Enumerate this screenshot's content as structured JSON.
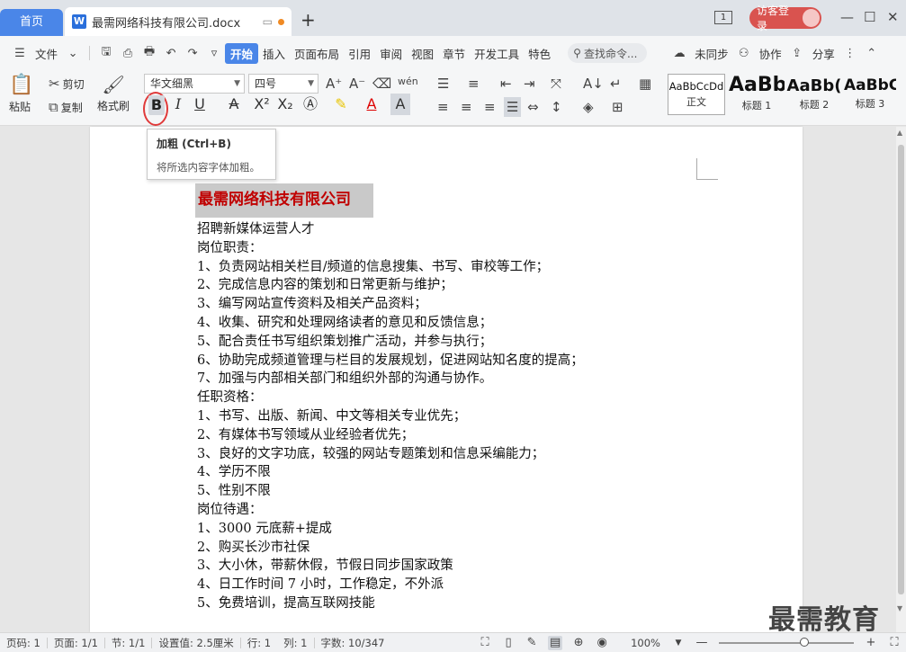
{
  "titlebar": {
    "home_tab": "首页",
    "doc_tab": "最需网络科技有限公司.docx",
    "doc_icon_letter": "W",
    "new_tab": "+",
    "login": "访客登录"
  },
  "menu": {
    "file": "文件",
    "items": [
      "开始",
      "插入",
      "页面布局",
      "引用",
      "审阅",
      "视图",
      "章节",
      "开发工具",
      "特色"
    ],
    "search_placeholder": "查找命令...",
    "sync": "未同步",
    "collab": "协作",
    "share": "分享"
  },
  "ribbon": {
    "paste": "粘贴",
    "cut": "剪切",
    "copy": "复制",
    "format_painter": "格式刷",
    "font_name": "华文细黑",
    "font_size": "四号",
    "styles": [
      {
        "preview": "AaBbCcDd",
        "name": "正文"
      },
      {
        "preview": "AaBb",
        "name": "标题 1"
      },
      {
        "preview": "AaBb(",
        "name": "标题 2"
      },
      {
        "preview": "AaBbC",
        "name": "标题 3"
      }
    ]
  },
  "tooltip": {
    "title": "加粗 (Ctrl+B)",
    "desc": "将所选内容字体加粗。"
  },
  "document": {
    "title": "最需网络科技有限公司",
    "lines": [
      "招聘新媒体运营人才",
      "岗位职责：",
      "1、负责网站相关栏目/频道的信息搜集、书写、审校等工作；",
      "2、完成信息内容的策划和日常更新与维护；",
      "3、编写网站宣传资料及相关产品资料；",
      "4、收集、研究和处理网络读者的意见和反馈信息；",
      "5、配合责任书写组织策划推广活动，并参与执行；",
      "6、协助完成频道管理与栏目的发展规划，促进网站知名度的提高；",
      "7、加强与内部相关部门和组织外部的沟通与协作。",
      "任职资格：",
      "1、书写、出版、新闻、中文等相关专业优先；",
      "2、有媒体书写领域从业经验者优先；",
      "3、良好的文字功底，较强的网站专题策划和信息采编能力；",
      "4、学历不限",
      "5、性别不限",
      "岗位待遇：",
      "1、3000 元底薪+提成",
      "2、购买长沙市社保",
      "3、大小休，带薪休假，节假日同步国家政策",
      "4、日工作时间 7 小时，工作稳定，不外派",
      "5、免费培训，提高互联网技能"
    ]
  },
  "watermark": "最需教育",
  "status": {
    "page_code": "页码: 1",
    "page": "页面: 1/1",
    "section": "节: 1/1",
    "setting": "设置值: 2.5厘米",
    "row": "行: 1",
    "col": "列: 1",
    "words": "字数: 10/347",
    "zoom": "100%"
  },
  "colors": {
    "accent": "#4a86e8",
    "title_red": "#c00000",
    "login_red": "#d9534f"
  }
}
